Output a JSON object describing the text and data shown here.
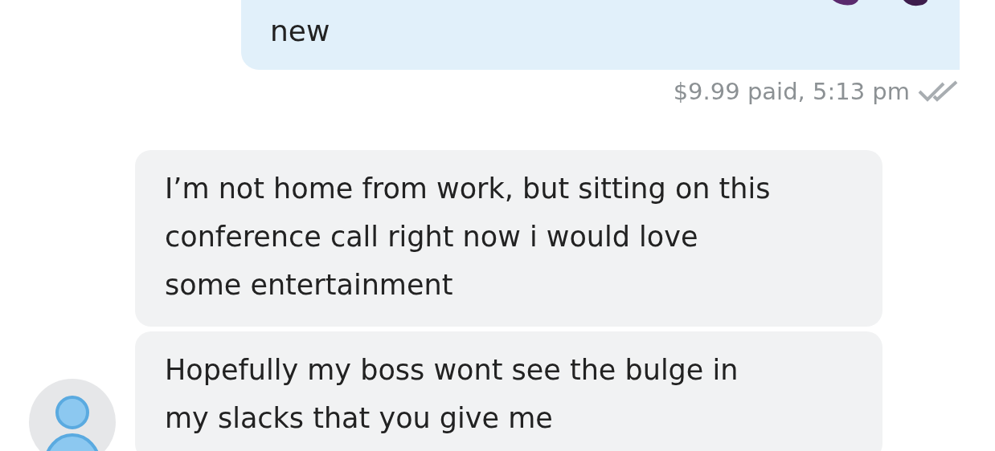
{
  "messages": [
    {
      "kind": "outgoing",
      "text": "new",
      "meta": "$9.99 paid, 5:13 pm",
      "read": true
    },
    {
      "kind": "incoming",
      "text": "I’m not home from work, but sitting on this conference call right now i would love some entertainment",
      "avatar": false
    },
    {
      "kind": "incoming",
      "text": "Hopefully my boss wont see the bulge in my slacks that you give me",
      "avatar": true
    }
  ]
}
